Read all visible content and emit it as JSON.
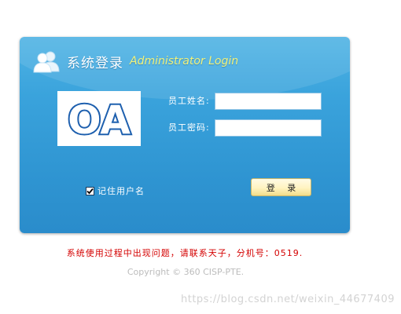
{
  "header": {
    "title": "系统登录",
    "subtitle": "Administrator Login",
    "icon": "users-icon"
  },
  "logo": {
    "text": "OA",
    "icon": "oa-logo",
    "colors": {
      "primary": "#1d5fae",
      "fill": "#ffffff"
    }
  },
  "form": {
    "username_label": "员工姓名:",
    "username_value": "",
    "password_label": "员工密码:",
    "password_value": "",
    "remember_label": "记住用户名",
    "remember_checked": true,
    "login_button": "登 录"
  },
  "notice": "系统使用过程中出现问题，请联系天子，分机号：0519.",
  "copyright": "Copyright © 360 CISP-PTE.",
  "watermark": "https://blog.csdn.net/weixin_44677409",
  "colors": {
    "panel": "#3aa3dc",
    "subtitle": "#f2f27a",
    "notice": "#d40000",
    "button": "#fff3c0"
  }
}
